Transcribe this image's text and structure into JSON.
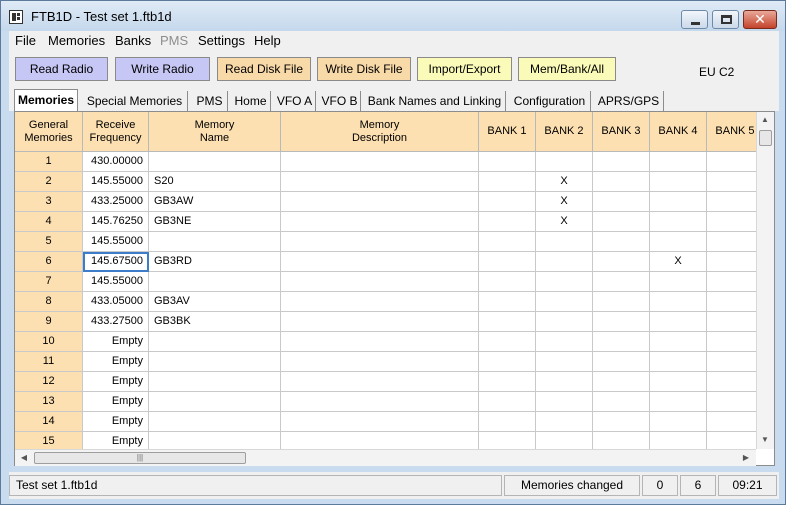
{
  "window": {
    "title": "FTB1D - Test set 1.ftb1d"
  },
  "menu": [
    "File",
    "Memories",
    "Banks",
    "PMS",
    "Settings",
    "Help"
  ],
  "toolbar": {
    "read_radio": "Read Radio",
    "write_radio": "Write Radio",
    "read_disk": "Read Disk File",
    "write_disk": "Write Disk File",
    "import_export": "Import/Export",
    "mem_bank_all": "Mem/Bank/All",
    "region": "EU C2"
  },
  "tabs": [
    "Memories",
    "Special Memories",
    "PMS",
    "Home",
    "VFO A",
    "VFO B",
    "Bank Names and Linking",
    "Configuration",
    "APRS/GPS"
  ],
  "grid": {
    "headers": {
      "general": "General\nMemories",
      "freq": "Receive\nFrequency",
      "name": "Memory\nName",
      "desc": "Memory\nDescription",
      "bank1": "BANK 1",
      "bank2": "BANK 2",
      "bank3": "BANK 3",
      "bank4": "BANK 4",
      "bank5": "BANK 5"
    },
    "rows": [
      {
        "num": "1",
        "freq": "430.00000",
        "name": "",
        "desc": "",
        "b1": "",
        "b2": "",
        "b3": "",
        "b4": "",
        "b5": ""
      },
      {
        "num": "2",
        "freq": "145.55000",
        "name": "S20",
        "desc": "",
        "b1": "",
        "b2": "X",
        "b3": "",
        "b4": "",
        "b5": ""
      },
      {
        "num": "3",
        "freq": "433.25000",
        "name": "GB3AW",
        "desc": "",
        "b1": "",
        "b2": "X",
        "b3": "",
        "b4": "",
        "b5": ""
      },
      {
        "num": "4",
        "freq": "145.76250",
        "name": "GB3NE",
        "desc": "",
        "b1": "",
        "b2": "X",
        "b3": "",
        "b4": "",
        "b5": ""
      },
      {
        "num": "5",
        "freq": "145.55000",
        "name": "",
        "desc": "",
        "b1": "",
        "b2": "",
        "b3": "",
        "b4": "",
        "b5": ""
      },
      {
        "num": "6",
        "freq": "145.67500",
        "name": "GB3RD",
        "desc": "",
        "b1": "",
        "b2": "",
        "b3": "",
        "b4": "X",
        "b5": ""
      },
      {
        "num": "7",
        "freq": "145.55000",
        "name": "",
        "desc": "",
        "b1": "",
        "b2": "",
        "b3": "",
        "b4": "",
        "b5": ""
      },
      {
        "num": "8",
        "freq": "433.05000",
        "name": "GB3AV",
        "desc": "",
        "b1": "",
        "b2": "",
        "b3": "",
        "b4": "",
        "b5": ""
      },
      {
        "num": "9",
        "freq": "433.27500",
        "name": "GB3BK",
        "desc": "",
        "b1": "",
        "b2": "",
        "b3": "",
        "b4": "",
        "b5": ""
      },
      {
        "num": "10",
        "freq": "Empty",
        "name": "",
        "desc": "",
        "b1": "",
        "b2": "",
        "b3": "",
        "b4": "",
        "b5": ""
      },
      {
        "num": "11",
        "freq": "Empty",
        "name": "",
        "desc": "",
        "b1": "",
        "b2": "",
        "b3": "",
        "b4": "",
        "b5": ""
      },
      {
        "num": "12",
        "freq": "Empty",
        "name": "",
        "desc": "",
        "b1": "",
        "b2": "",
        "b3": "",
        "b4": "",
        "b5": ""
      },
      {
        "num": "13",
        "freq": "Empty",
        "name": "",
        "desc": "",
        "b1": "",
        "b2": "",
        "b3": "",
        "b4": "",
        "b5": ""
      },
      {
        "num": "14",
        "freq": "Empty",
        "name": "",
        "desc": "",
        "b1": "",
        "b2": "",
        "b3": "",
        "b4": "",
        "b5": ""
      },
      {
        "num": "15",
        "freq": "Empty",
        "name": "",
        "desc": "",
        "b1": "",
        "b2": "",
        "b3": "",
        "b4": "",
        "b5": ""
      }
    ],
    "hscroll_grip": "|||"
  },
  "status": {
    "file": "Test set 1.ftb1d",
    "message": "Memories changed",
    "count_a": "0",
    "count_b": "6",
    "time": "09:21"
  },
  "colors": {
    "header_bg": "#fde0b2",
    "button_blue": "#c7c7f5",
    "button_orange": "#f8d9a8",
    "button_yellow": "#fbfbb9",
    "selection": "#3d7cc9"
  }
}
